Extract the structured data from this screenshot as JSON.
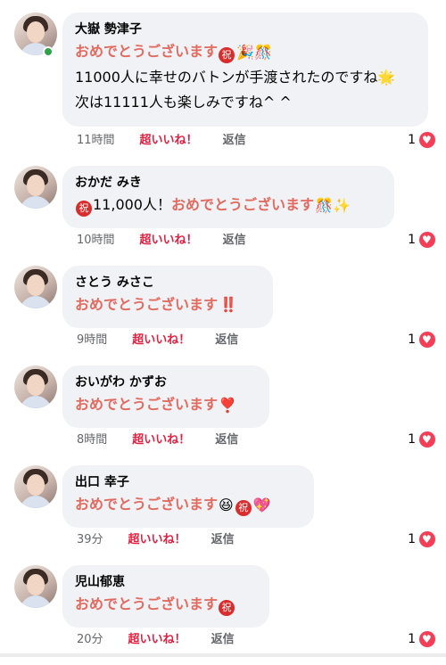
{
  "comments": [
    {
      "name": "大嶽 勢津子",
      "lines": [
        {
          "congrats": "おめでとうございます",
          "badge": "祝",
          "glyphs": "🎉🎊"
        },
        {
          "text": "11000人に幸せのバトンが手渡されたのですね🌟"
        },
        {
          "text": "次は11111人も楽しみですね^ ^"
        }
      ],
      "time": "11時間",
      "like": "超いいね！",
      "reply": "返信",
      "count": "1",
      "online": true
    },
    {
      "name": "おかだ みき",
      "lines": [
        {
          "badge": "祝",
          "text": "11,000人！",
          "congrats": "おめでとうございます",
          "glyphs": "🎊✨"
        }
      ],
      "time": "10時間",
      "like": "超いいね！",
      "reply": "返信",
      "count": "1"
    },
    {
      "name": "さとう みさこ",
      "lines": [
        {
          "congrats": "おめでとうございます",
          "bangs": "‼️"
        }
      ],
      "time": "9時間",
      "like": "超いいね！",
      "reply": "返信",
      "count": "1"
    },
    {
      "name": "おいがわ かずお",
      "lines": [
        {
          "congrats": "おめでとうございます",
          "glyphs": "❣️"
        }
      ],
      "time": "8時間",
      "like": "超いいね！",
      "reply": "返信",
      "count": "1"
    },
    {
      "name": "出口 幸子",
      "lines": [
        {
          "congrats": "おめでとうございます",
          "glyphs": "😆",
          "badge": "祝",
          "glyphs2": "💖"
        }
      ],
      "time": "39分",
      "like": "超いいね！",
      "reply": "返信",
      "count": "1"
    },
    {
      "name": "児山郁恵",
      "lines": [
        {
          "congrats": "おめでとうございます",
          "badge": "祝"
        }
      ],
      "time": "20分",
      "like": "超いいね！",
      "reply": "返信",
      "count": "1"
    }
  ],
  "colors": {
    "bubble": "#f0f2f5",
    "congrats": "#e26a5f",
    "like": "#e41e3f",
    "heart": "#f33e58",
    "online": "#31a24c"
  }
}
